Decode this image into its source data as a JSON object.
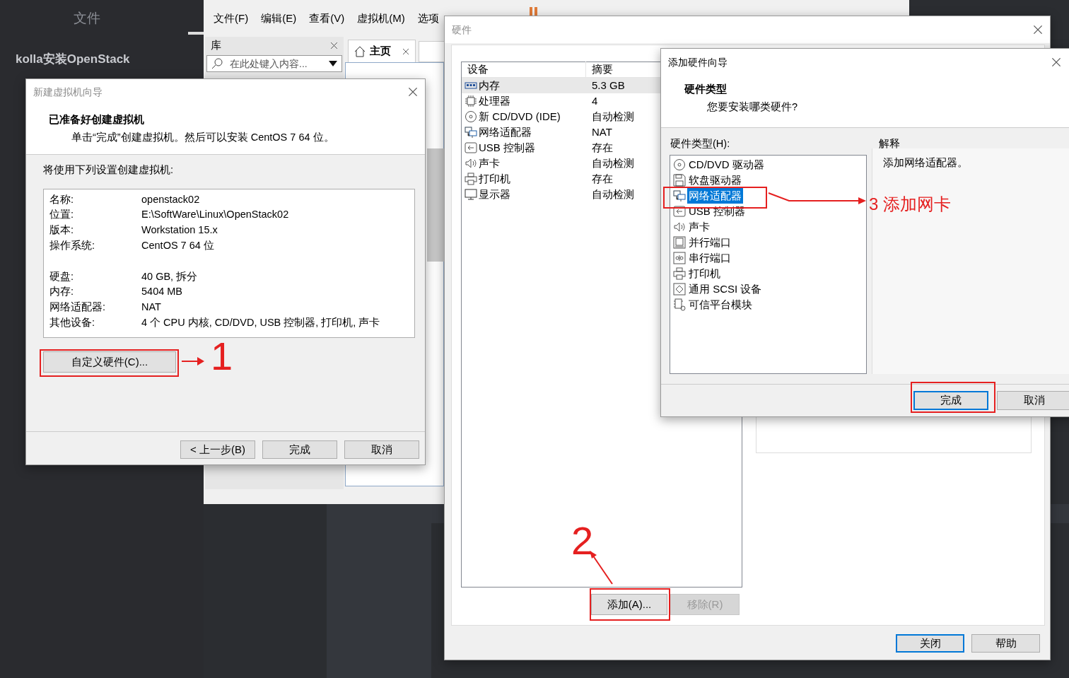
{
  "editor": {
    "tab": "文件",
    "article_title": "kolla安装OpenStack"
  },
  "vmware": {
    "menu": [
      "文件(F)",
      "编辑(E)",
      "查看(V)",
      "虚拟机(M)",
      "选项"
    ],
    "library": {
      "title": "库",
      "search": {
        "placeholder": "在此处键入内容..."
      }
    },
    "tabs": [
      {
        "label": "主页",
        "selected": true
      }
    ]
  },
  "new_vm_wizard": {
    "title": "新建虚拟机向导",
    "heading": "已准备好创建虚拟机",
    "subtitle": "单击“完成”创建虚拟机。然后可以安装 CentOS 7 64 位。",
    "intro": "将使用下列设置创建虚拟机:",
    "summary_groups": [
      [
        {
          "label": "名称:",
          "value": "openstack02"
        },
        {
          "label": "位置:",
          "value": "E:\\SoftWare\\Linux\\OpenStack02"
        },
        {
          "label": "版本:",
          "value": "Workstation 15.x"
        },
        {
          "label": "操作系统:",
          "value": "CentOS 7 64 位"
        }
      ],
      [
        {
          "label": "硬盘:",
          "value": "40 GB, 拆分"
        },
        {
          "label": "内存:",
          "value": "5404 MB"
        },
        {
          "label": "网络适配器:",
          "value": "NAT"
        },
        {
          "label": "其他设备:",
          "value": "4 个 CPU 内核, CD/DVD, USB 控制器, 打印机, 声卡"
        }
      ]
    ],
    "customize_button": "自定义硬件(C)...",
    "buttons": [
      "< 上一步(B)",
      "完成",
      "取消"
    ]
  },
  "hardware_dialog": {
    "title": "硬件",
    "columns": [
      "设备",
      "摘要"
    ],
    "devices": [
      {
        "name": "内存",
        "summary": "5.3 GB",
        "kind": "memory",
        "selected": true
      },
      {
        "name": "处理器",
        "summary": "4",
        "kind": "cpu",
        "selected": false
      },
      {
        "name": "新 CD/DVD (IDE)",
        "summary": "自动检测",
        "kind": "cdrom",
        "selected": false
      },
      {
        "name": "网络适配器",
        "summary": "NAT",
        "kind": "network",
        "selected": false
      },
      {
        "name": "USB 控制器",
        "summary": "存在",
        "kind": "usb",
        "selected": false
      },
      {
        "name": "声卡",
        "summary": "自动检测",
        "kind": "sound",
        "selected": false
      },
      {
        "name": "打印机",
        "summary": "存在",
        "kind": "printer",
        "selected": false
      },
      {
        "name": "显示器",
        "summary": "自动检测",
        "kind": "display",
        "selected": false
      }
    ],
    "list_buttons": [
      {
        "label": "添加(A)...",
        "disabled": false
      },
      {
        "label": "移除(R)",
        "disabled": true
      }
    ],
    "footer_buttons": [
      {
        "label": "关闭",
        "default": true
      },
      {
        "label": "帮助",
        "default": false
      }
    ]
  },
  "add_hardware_wizard": {
    "title": "添加硬件向导",
    "heading": "硬件类型",
    "question": "您要安装哪类硬件?",
    "list_label": "硬件类型(H):",
    "hardware_types": [
      {
        "name": "CD/DVD 驱动器",
        "kind": "cdrom",
        "selected": false
      },
      {
        "name": "软盘驱动器",
        "kind": "floppy",
        "selected": false
      },
      {
        "name": "网络适配器",
        "kind": "network",
        "selected": true
      },
      {
        "name": "USB 控制器",
        "kind": "usb",
        "selected": false
      },
      {
        "name": "声卡",
        "kind": "sound",
        "selected": false
      },
      {
        "name": "并行端口",
        "kind": "parallel",
        "selected": false
      },
      {
        "name": "串行端口",
        "kind": "serial",
        "selected": false
      },
      {
        "name": "打印机",
        "kind": "printer",
        "selected": false
      },
      {
        "name": "通用 SCSI 设备",
        "kind": "scsi",
        "selected": false
      },
      {
        "name": "可信平台模块",
        "kind": "tpm",
        "selected": false
      }
    ],
    "explanation_label": "解释",
    "explanation": "添加网络适配器。",
    "buttons": [
      {
        "label": "完成",
        "default": true
      },
      {
        "label": "取消",
        "default": false
      }
    ]
  },
  "annotations": [
    {
      "label": "1"
    },
    {
      "label": "2"
    },
    {
      "label": "3 添加网卡"
    }
  ]
}
